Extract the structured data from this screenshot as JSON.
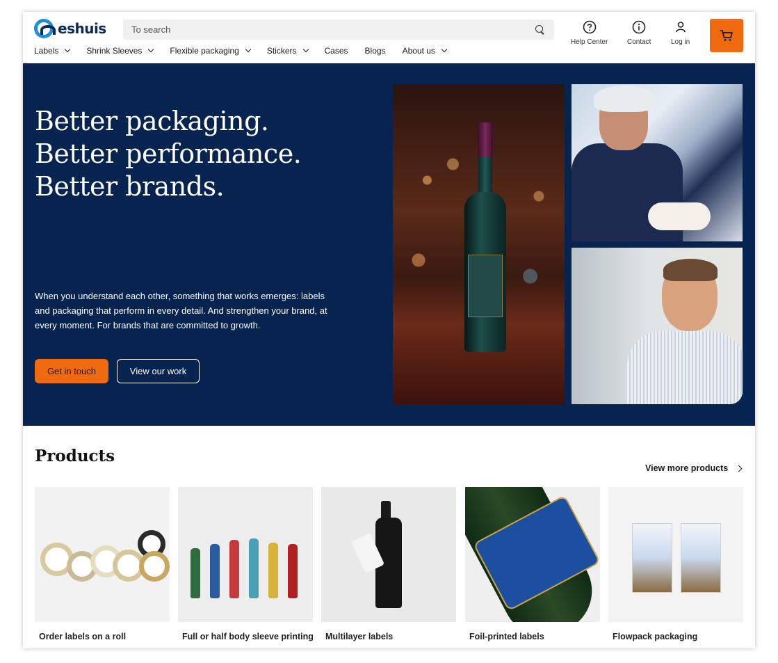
{
  "header": {
    "logo_text": "eshuis",
    "search": {
      "placeholder": "To search"
    },
    "nav": [
      {
        "label": "Labels",
        "has_dropdown": true
      },
      {
        "label": "Shrink Sleeves",
        "has_dropdown": true
      },
      {
        "label": "Flexible packaging",
        "has_dropdown": true
      },
      {
        "label": "Stickers",
        "has_dropdown": true
      },
      {
        "label": "Cases",
        "has_dropdown": false
      },
      {
        "label": "Blogs",
        "has_dropdown": false
      },
      {
        "label": "About us",
        "has_dropdown": true
      }
    ],
    "utilities": {
      "help": "Help Center",
      "contact": "Contact",
      "login": "Log in"
    },
    "cart_icon": "cart-icon"
  },
  "hero": {
    "title_lines": [
      "Better packaging.",
      "Better performance.",
      "Better brands."
    ],
    "text": "When you understand each other, something that works emerges: labels and packaging that perform in every detail. And strengthen your brand, at every moment. For brands that are committed to growth.",
    "primary_button": "Get in touch",
    "secondary_button": "View our work",
    "background_color": "#06244f",
    "accent_color": "#f06a10"
  },
  "products": {
    "title": "Products",
    "view_more": "View more products",
    "items": [
      {
        "label": "Order labels on a roll"
      },
      {
        "label": "Full or half body sleeve printing"
      },
      {
        "label": "Multilayer labels"
      },
      {
        "label": "Foil-printed labels"
      },
      {
        "label": "Flowpack packaging"
      }
    ]
  }
}
